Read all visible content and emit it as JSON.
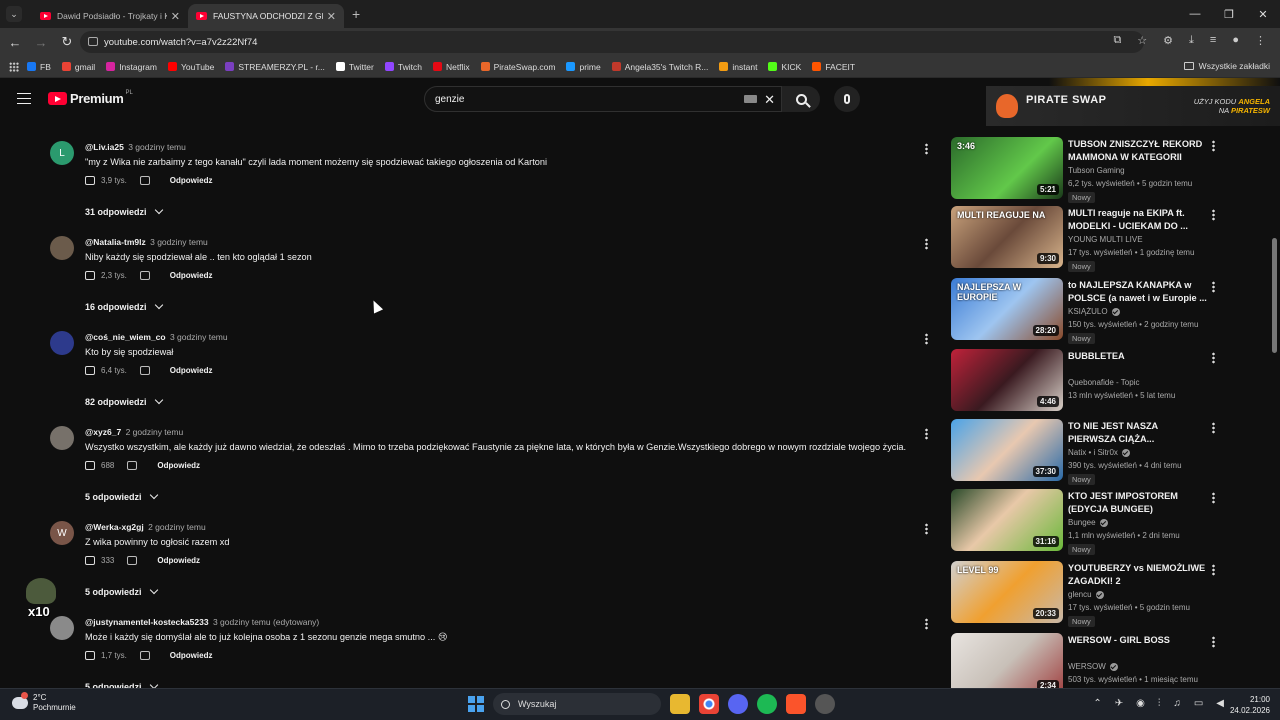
{
  "browser": {
    "tabs": [
      {
        "title": "Dawid Podsiadło - Trojkaty i Kw",
        "active": false
      },
      {
        "title": "FAUSTYNA ODCHODZI Z GENZ",
        "active": true
      }
    ],
    "url": "youtube.com/watch?v=a7v2z22Nf74",
    "bookmarks": [
      {
        "label": "FB",
        "color": "#1877f2"
      },
      {
        "label": "gmail",
        "color": "#ea4335"
      },
      {
        "label": "Instagram",
        "color": "#d6249f"
      },
      {
        "label": "YouTube",
        "color": "#ff0000"
      },
      {
        "label": "STREAMERZY.PL - r...",
        "color": "#7a3fc0"
      },
      {
        "label": "Twitter",
        "color": "#ffffff"
      },
      {
        "label": "Twitch",
        "color": "#9146ff"
      },
      {
        "label": "Netflix",
        "color": "#e50914"
      },
      {
        "label": "PirateSwap.com",
        "color": "#e8672a"
      },
      {
        "label": "prime",
        "color": "#1a98ff"
      },
      {
        "label": "Angela35's Twitch R...",
        "color": "#c0392b"
      },
      {
        "label": "instant",
        "color": "#f39c12"
      },
      {
        "label": "KICK",
        "color": "#53fc18"
      },
      {
        "label": "FACEIT",
        "color": "#ff5500"
      }
    ],
    "bookmarks_all": "Wszystkie zakładki"
  },
  "youtube": {
    "logo": "Premium",
    "logo_region": "PL",
    "search_value": "genzie"
  },
  "comments": [
    {
      "avatar_letter": "L",
      "avatar_color": "#2b9a6e",
      "user": "@Liv.ia25",
      "time": "3 godziny temu",
      "text": "\"my z Wika nie zarbaimy z tego kanału\" czyli lada moment możemy się spodziewać takiego ogłoszenia od Kartoni",
      "likes": "3,9 tys.",
      "reply": "Odpowiedz",
      "replies": "31 odpowiedzi"
    },
    {
      "avatar_letter": "",
      "avatar_color": "#6b5b4b",
      "user": "@Natalia-tm9lz",
      "time": "3 godziny temu",
      "text": "Niby każdy się spodziewał ale .. ten kto oglądał 1 sezon",
      "likes": "2,3 tys.",
      "reply": "Odpowiedz",
      "replies": "16 odpowiedzi"
    },
    {
      "avatar_letter": "",
      "avatar_color": "#2d3a8c",
      "user": "@coś_nie_wiem_co",
      "time": "3 godziny temu",
      "text": "Kto by się spodziewał",
      "likes": "6,4 tys.",
      "reply": "Odpowiedz",
      "replies": "82 odpowiedzi"
    },
    {
      "avatar_letter": "",
      "avatar_color": "#77716a",
      "user": "@xyz6_7",
      "time": "2 godziny temu",
      "text": "Wszystko wszystkim, ale każdy już dawno wiedział, że odeszłaś . Mimo to trzeba podziękować Faustynie za piękne lata, w których była w Genzie.Wszystkiego dobrego w nowym rozdziale twojego życia.",
      "likes": "688",
      "reply": "Odpowiedz",
      "replies": "5 odpowiedzi"
    },
    {
      "avatar_letter": "W",
      "avatar_color": "#795548",
      "user": "@Werka-xg2gj",
      "time": "2 godziny temu",
      "text": "Z wika powinny to ogłosić razem xd",
      "likes": "333",
      "reply": "Odpowiedz",
      "replies": "5 odpowiedzi"
    },
    {
      "avatar_letter": "",
      "avatar_color": "#8a8a8a",
      "user": "@justynamentel-kostecka5233",
      "time": "3 godziny temu (edytowany)",
      "text": "Może i każdy się domyślał ale to już kolejna osoba z 1 sezonu genzie mega smutno ... 😢",
      "likes": "1,7 tys.",
      "reply": "Odpowiedz",
      "replies": "5 odpowiedzi"
    }
  ],
  "ad": {
    "brand": "PIRATE SWAP",
    "line1": "UŻYJ KODU",
    "code": "ANGELA",
    "line2": "NA",
    "site": "PIRATESW"
  },
  "videos": [
    {
      "title": "TUBSON ZNISZCZYŁ REKORD MAMMONA W KATEGORII SET...",
      "channel": "Tubson Gaming",
      "verified": false,
      "stats": "6,2 tys. wyświetleń • 5 godzin temu",
      "badge": "Nowy",
      "duration": "5:21",
      "thumb_caption": "3:46",
      "thumb_bg": "linear-gradient(135deg,#2b6b2b,#62c84a 60%,#1a3a1a)"
    },
    {
      "title": "MULTI reaguje na EKIPA ft. MODELKI - UCIEKAM DO ...",
      "channel": "YOUNG MULTI LIVE",
      "verified": false,
      "stats": "17 tys. wyświetleń • 1 godzinę temu",
      "badge": "Nowy",
      "duration": "9:30",
      "thumb_caption": "MULTI REAGUJE NA",
      "thumb_bg": "linear-gradient(135deg,#c9a27c,#6a4a3a 50%,#d8b48c)"
    },
    {
      "title": "to NAJLEPSZA KANAPKA w POLSCE (a nawet i w Europie ...",
      "channel": "KSIĄŻULO",
      "verified": true,
      "stats": "150 tys. wyświetleń • 2 godziny temu",
      "badge": "Nowy",
      "duration": "28:20",
      "thumb_caption": "NAJLEPSZA W EUROPIE",
      "thumb_bg": "linear-gradient(135deg,#3a7bd5,#9ec5f0 50%,#8a4a2a)"
    },
    {
      "title": "BUBBLETEA",
      "channel": "Quebonafide - Topic",
      "verified": false,
      "stats": "13 mln wyświetleń • 5 lat temu",
      "badge": "",
      "duration": "4:46",
      "thumb_caption": "",
      "thumb_bg": "linear-gradient(135deg,#c0223a,#3a1a20 50%,#d8d0c8)"
    },
    {
      "title": "TO NIE JEST NASZA PIERWSZA CIĄŻA...",
      "channel": "Natix • i Sitr0x",
      "verified": true,
      "stats": "390 tys. wyświetleń • 4 dni temu",
      "badge": "Nowy",
      "duration": "37:30",
      "thumb_caption": "",
      "thumb_bg": "linear-gradient(135deg,#4aa3e8,#e8c8b0 50%,#2a6aa8)"
    },
    {
      "title": "KTO JEST IMPOSTOREM (EDYCJA BUNGEE)",
      "channel": "Bungee",
      "verified": true,
      "stats": "1,1 mln wyświetleń • 2 dni temu",
      "badge": "Nowy",
      "duration": "31:16",
      "thumb_caption": "",
      "thumb_bg": "linear-gradient(135deg,#2a4a2a,#e8c8a8 45%,#6ab83a)"
    },
    {
      "title": "YOUTUBERZY vs NIEMOŻLIWE ZAGADKI! 2",
      "channel": "glencu",
      "verified": true,
      "stats": "17 tys. wyświetleń • 5 godzin temu",
      "badge": "Nowy",
      "duration": "20:33",
      "thumb_caption": "LEVEL 99",
      "thumb_bg": "linear-gradient(135deg,#d0d0d0,#f0a030 50%,#c8b8a8)"
    },
    {
      "title": "WERSOW - GIRL BOSS",
      "channel": "WERSOW",
      "verified": true,
      "stats": "503 tys. wyświetleń • 1 miesiąc temu",
      "badge": "",
      "duration": "2:34",
      "thumb_caption": "",
      "thumb_bg": "linear-gradient(135deg,#e8e4e0,#c8c0b8 50%,#a04040)"
    }
  ],
  "overlay": {
    "label": "x10"
  },
  "taskbar": {
    "temp": "2°C",
    "weather": "Pochmurnie",
    "search": "Wyszukaj",
    "time": "21:00",
    "date": "24.02.2026"
  }
}
